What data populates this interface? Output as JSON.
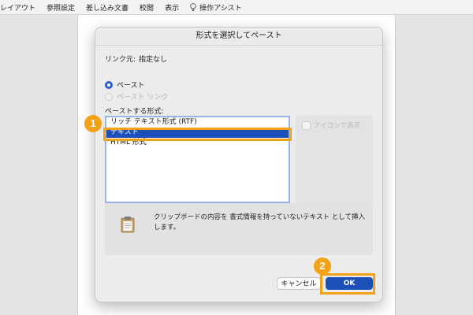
{
  "ribbon": {
    "tabs": [
      "レイアウト",
      "参照設定",
      "差し込み文書",
      "校閲",
      "表示",
      "操作アシスト"
    ]
  },
  "dialog": {
    "title": "形式を選択してペースト",
    "source_label": "リンク元:",
    "source_value": "指定なし",
    "radio_paste": "ペースト",
    "radio_paste_link": "ペースト リンク",
    "format_label": "ペーストする形式:",
    "formats": [
      "リッチ テキスト形式 (RTF)",
      "テキスト",
      "HTML 形式"
    ],
    "selected_format": "テキスト",
    "icon_checkbox_label": "アイコンで表示",
    "result_text": "クリップボードの内容を 書式情報を持っていないテキスト として挿入します。",
    "cancel_label": "キャンセル",
    "ok_label": "OK"
  },
  "annotations": {
    "step1": "1",
    "step2": "2",
    "highlight_color": "#f2a118"
  },
  "icons": [
    "lightbulb-icon",
    "clipboard-icon"
  ],
  "colors": {
    "accent": "#1c4fb8",
    "annotation": "#f2a118"
  }
}
